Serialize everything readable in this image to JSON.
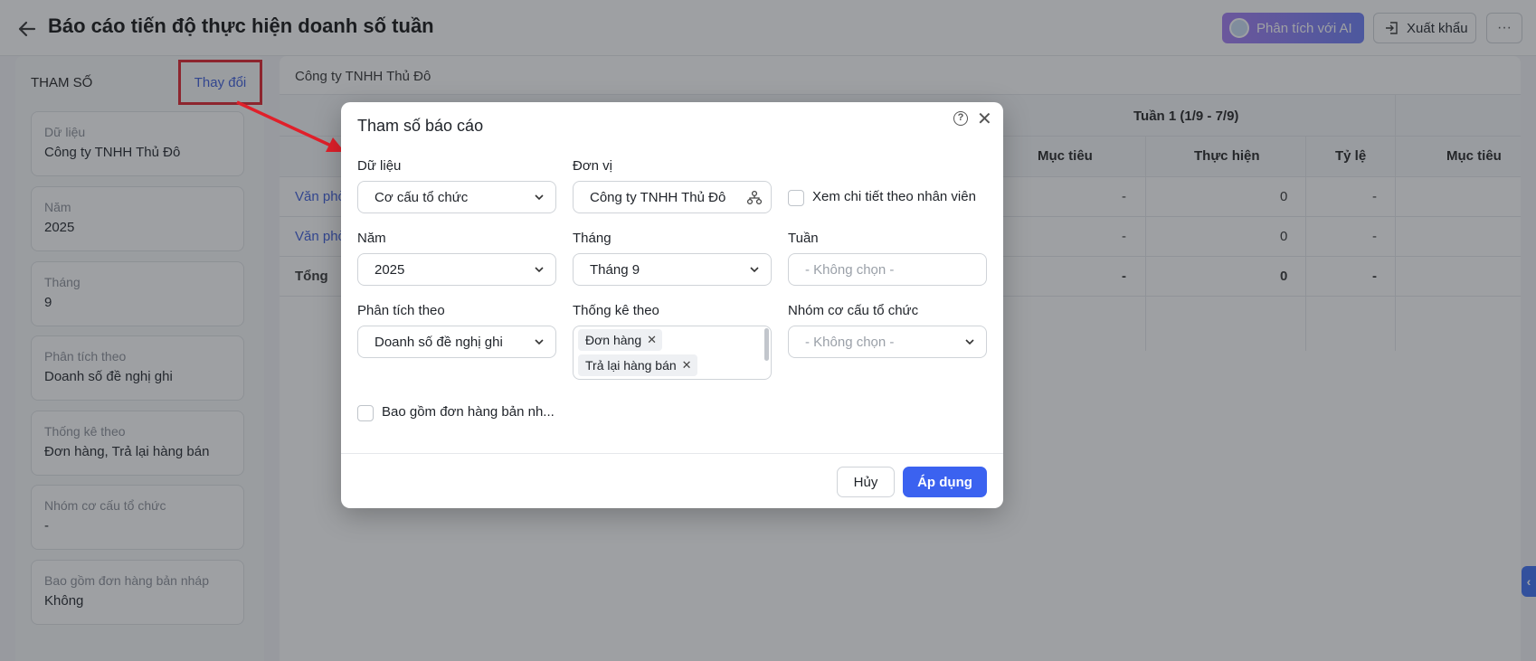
{
  "header": {
    "title": "Báo cáo tiến độ thực hiện doanh số tuần",
    "ai_button": "Phân tích với AI",
    "export_button": "Xuất khẩu",
    "more_button": "···"
  },
  "left_panel": {
    "heading": "THAM SỐ",
    "change_link": "Thay đổi",
    "params": [
      {
        "label": "Dữ liệu",
        "value": "Công ty TNHH Thủ Đô"
      },
      {
        "label": "Năm",
        "value": "2025"
      },
      {
        "label": "Tháng",
        "value": "9"
      },
      {
        "label": "Phân tích theo",
        "value": "Doanh số đề nghị ghi"
      },
      {
        "label": "Thống kê theo",
        "value": "Đơn hàng, Trả lại hàng bán"
      },
      {
        "label": "Nhóm cơ cấu tổ chức",
        "value": "-"
      },
      {
        "label": "Bao gồm đơn hàng bản nháp",
        "value": "Không"
      }
    ]
  },
  "report": {
    "company": "Công ty TNHH Thủ Đô",
    "week_header": "Tuần 1 (1/9 - 7/9)",
    "columns": [
      "Mục tiêu",
      "Thực hiện",
      "Tỷ lệ",
      "Mục tiêu"
    ],
    "rows": [
      {
        "name": "Văn phò",
        "target": "-",
        "actual": "0",
        "ratio": "-"
      },
      {
        "name": "Văn phò",
        "target": "-",
        "actual": "0",
        "ratio": "-"
      },
      {
        "name": "Tổng",
        "target": "-",
        "actual": "0",
        "ratio": "-"
      }
    ]
  },
  "modal": {
    "title": "Tham số báo cáo",
    "help_icon": "?",
    "close_icon": "✕",
    "data_label": "Dữ liệu",
    "data_value": "Cơ cấu tổ chức",
    "unit_label": "Đơn vị",
    "unit_value": "Công ty TNHH Thủ Đô",
    "detail_by_employee": "Xem chi tiết theo nhân viên",
    "year_label": "Năm",
    "year_value": "2025",
    "month_label": "Tháng",
    "month_value": "Tháng 9",
    "week_label": "Tuần",
    "week_placeholder": "- Không chọn -",
    "analyze_label": "Phân tích theo",
    "analyze_value": "Doanh số đề nghị ghi",
    "stat_label": "Thống kê theo",
    "stat_tags": [
      "Đơn hàng",
      "Trả lại hàng bán"
    ],
    "tag_remove": "✕",
    "org_group_label": "Nhóm cơ cấu tổ chức",
    "org_group_placeholder": "- Không chọn -",
    "include_draft": "Bao gồm đơn hàng bản nh...",
    "cancel_button": "Hủy",
    "apply_button": "Áp dụng"
  },
  "side_tab_icon": "‹"
}
